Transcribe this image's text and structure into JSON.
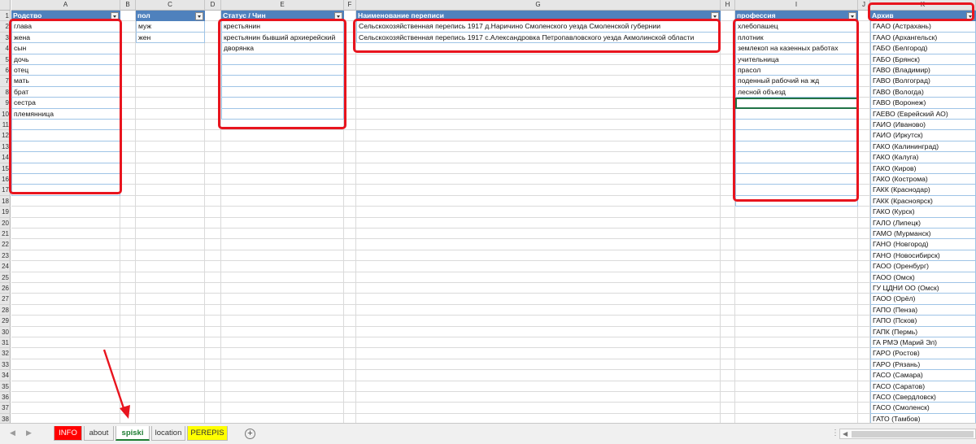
{
  "columns": [
    {
      "letter": "A",
      "header": "Родство",
      "table": true,
      "filter": true
    },
    {
      "letter": "B",
      "header": "",
      "table": false,
      "filter": false
    },
    {
      "letter": "C",
      "header": "пол",
      "table": true,
      "filter": true
    },
    {
      "letter": "D",
      "header": "",
      "table": false,
      "filter": false
    },
    {
      "letter": "E",
      "header": "Статус / Чин",
      "table": true,
      "filter": true
    },
    {
      "letter": "F",
      "header": "",
      "table": false,
      "filter": false
    },
    {
      "letter": "G",
      "header": "Наименование переписи",
      "table": true,
      "filter": true
    },
    {
      "letter": "H",
      "header": "",
      "table": false,
      "filter": false
    },
    {
      "letter": "I",
      "header": "профессия",
      "table": true,
      "filter": true
    },
    {
      "letter": "J",
      "header": "",
      "table": false,
      "filter": false
    },
    {
      "letter": "K",
      "header": "Архив",
      "table": true,
      "filter": true
    }
  ],
  "row_numbers": [
    "1",
    "2",
    "3",
    "4",
    "5",
    "6",
    "7",
    "8",
    "9",
    "10",
    "11",
    "12",
    "13",
    "14",
    "15",
    "16",
    "17",
    "18",
    "19",
    "20",
    "21",
    "22",
    "23",
    "24",
    "25",
    "26",
    "27",
    "28",
    "29",
    "30",
    "31",
    "32",
    "33",
    "34",
    "35",
    "36",
    "37",
    "38"
  ],
  "data": {
    "A": [
      "глава",
      "жена",
      "сын",
      "дочь",
      "отец",
      "мать",
      "брат",
      "сестра",
      "племянница"
    ],
    "C": [
      "муж",
      "жен"
    ],
    "E": [
      "крестьянин",
      "крестьянин бывший архиерейский",
      "дворянка"
    ],
    "G": [
      "Сельскохозяйственная перепись 1917  д.Наричино Смоленского уезда Смоленской губернии",
      "Сельскохозяйственная перепись 1917  с.Александровка Петропавловского уезда Акмолинской области"
    ],
    "I": [
      "хлебопашец",
      "плотник",
      "землекоп на казенных работах",
      "учительница",
      "прасол",
      "поденный рабочий на жд",
      "лесной объезд"
    ],
    "K": [
      "ГААО (Астрахань)",
      "ГААО (Архангельск)",
      "ГАБО (Белгород)",
      "ГАБО (Брянск)",
      "ГАВО (Владимир)",
      "ГАВО (Волгоград)",
      "ГАВО (Вологда)",
      "ГАВО (Воронеж)",
      "ГАЕВО (Еврейский АО)",
      "ГАИО (Иваново)",
      "ГАИО (Иркутск)",
      "ГАКО (Калининград)",
      "ГАКО (Калуга)",
      "ГАКО (Киров)",
      "ГАКО (Кострома)",
      "ГАКК (Краснодар)",
      "ГАКК (Красноярск)",
      "ГАКО (Курск)",
      "ГАЛО (Липецк)",
      "ГАМО (Мурманск)",
      "ГАНО (Новгород)",
      "ГАНО (Новосибирск)",
      "ГАОО (Оренбург)",
      "ГАОО (Омск)",
      "ГУ ЦДНИ ОО (Омск)",
      "ГАОО (Орёл)",
      "ГАПО (Пенза)",
      "ГАПО (Псков)",
      "ГАПК (Пермь)",
      "ГА РМЭ (Марий Эл)",
      "ГАРО (Ростов)",
      "ГАРО (Рязань)",
      "ГАСО (Самара)",
      "ГАСО (Саратов)",
      "ГАСО (Свердловск)",
      "ГАСО (Смоленск)",
      "ГАТО (Тамбов)"
    ]
  },
  "sheet_tabs": [
    {
      "label": "INFO",
      "bg": "#ff0000",
      "color": "#ffffff",
      "active": false
    },
    {
      "label": "about",
      "bg": "#f0f0f0",
      "color": "#333333",
      "active": false
    },
    {
      "label": "spiski",
      "bg": "#ffffff",
      "color": "#1e7d32",
      "active": true
    },
    {
      "label": "location",
      "bg": "#f0f0f0",
      "color": "#333333",
      "active": false
    },
    {
      "label": "PEREPIS",
      "bg": "#ffff00",
      "color": "#333333",
      "active": false
    }
  ],
  "colors": {
    "table_header": "#4f81bd",
    "annotation_red": "#e8141e",
    "active_tab_text": "#1e7d32"
  },
  "icons": {
    "filter": "filter-dropdown-icon",
    "add_sheet": "plus-circle-icon",
    "arrow": "red-arrow-annotation-icon"
  }
}
